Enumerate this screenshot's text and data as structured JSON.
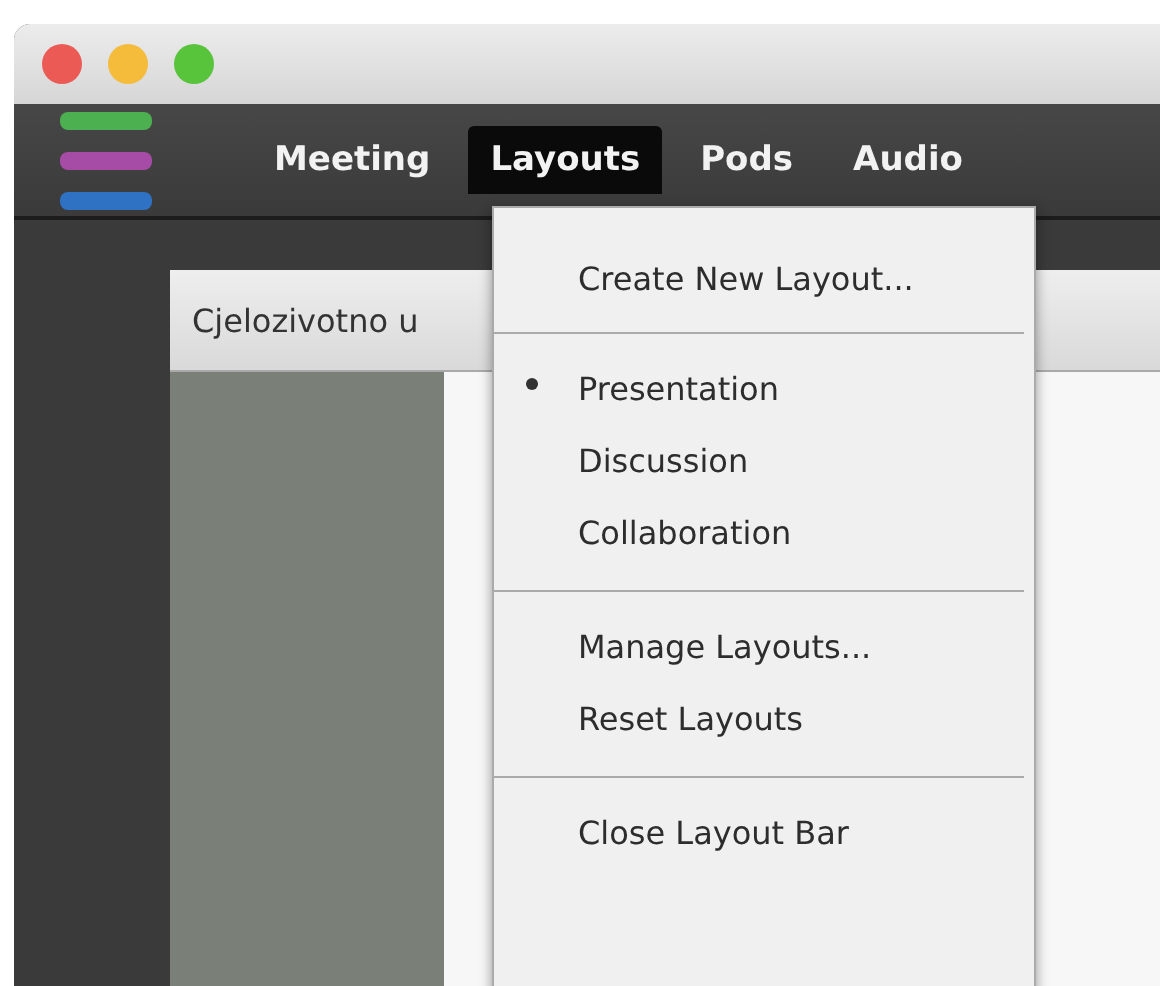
{
  "menu_bar": [
    {
      "label": "Meeting",
      "selected": false
    },
    {
      "label": "Layouts",
      "selected": true
    },
    {
      "label": "Pods",
      "selected": false
    },
    {
      "label": "Audio",
      "selected": false
    }
  ],
  "pod": {
    "title": "Cjelozivotno u"
  },
  "dropdown": {
    "sections": [
      {
        "items": [
          {
            "label": "Create New Layout...",
            "selected": false
          }
        ]
      },
      {
        "items": [
          {
            "label": "Presentation",
            "selected": true
          },
          {
            "label": "Discussion",
            "selected": false
          },
          {
            "label": "Collaboration",
            "selected": false
          }
        ]
      },
      {
        "items": [
          {
            "label": "Manage Layouts...",
            "selected": false
          },
          {
            "label": "Reset Layouts",
            "selected": false
          }
        ]
      },
      {
        "items": [
          {
            "label": "Close Layout Bar",
            "selected": false
          }
        ]
      }
    ]
  }
}
